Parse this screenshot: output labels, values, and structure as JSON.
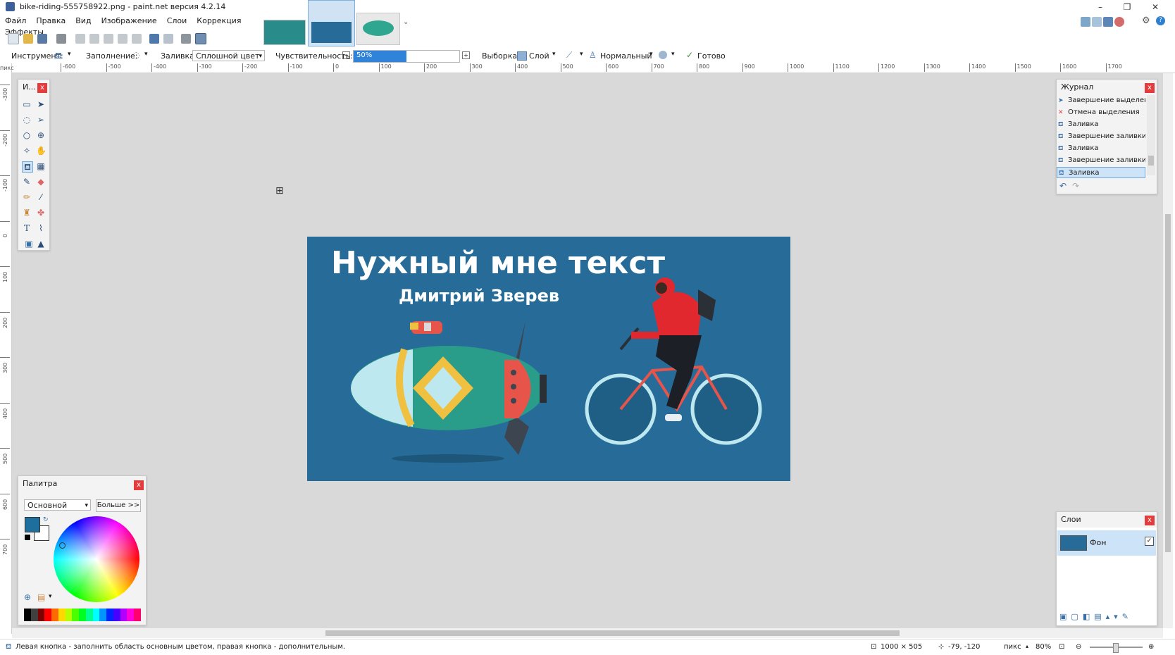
{
  "window": {
    "title": "bike-riding-555758922.png - paint.net версия 4.2.14",
    "minimize": "–",
    "restore": "❐",
    "close": "✕"
  },
  "menu": [
    "Файл",
    "Правка",
    "Вид",
    "Изображение",
    "Слои",
    "Коррекция",
    "Эффекты"
  ],
  "options": {
    "tool_label": "Инструмент:",
    "fillmode_label": "Заполнение:",
    "fill_label": "Заливка:",
    "fill_value": "Сплошной цвет",
    "tolerance_label": "Чувствительность:",
    "tolerance_value": "50%",
    "tolerance_fraction": 0.5,
    "sampling_label": "Выборка:",
    "sampling_value": "Слой",
    "blend_value": "Нормальный",
    "finish_label": "Готово"
  },
  "ruler": {
    "unit": "пикс",
    "h_ticks": [
      "-600",
      "-500",
      "-400",
      "-300",
      "-200",
      "-100",
      "0",
      "100",
      "200",
      "300",
      "400",
      "500",
      "600",
      "700",
      "800",
      "900",
      "1000",
      "1100",
      "1200",
      "1300",
      "1400",
      "1500",
      "1600",
      "1700"
    ],
    "v_ticks": [
      "-300",
      "-200",
      "-100",
      "0",
      "100",
      "200",
      "300",
      "400",
      "500",
      "600",
      "700"
    ]
  },
  "tools_panel": {
    "title": "И...",
    "close": "x"
  },
  "canvas_image": {
    "title": "Нужный мне текст",
    "subtitle": "Дмитрий Зверев",
    "bg_color": "#276c98"
  },
  "history": {
    "title": "Журнал",
    "close": "x",
    "items": [
      {
        "label": "Завершение выделения",
        "icon": "select-icon"
      },
      {
        "label": "Отмена выделения",
        "icon": "deselect-icon"
      },
      {
        "label": "Заливка",
        "icon": "bucket-icon"
      },
      {
        "label": "Завершение заливки",
        "icon": "bucket-icon"
      },
      {
        "label": "Заливка",
        "icon": "bucket-icon"
      },
      {
        "label": "Завершение заливки",
        "icon": "bucket-icon"
      },
      {
        "label": "Заливка",
        "icon": "bucket-icon"
      }
    ]
  },
  "palette": {
    "title": "Палитра",
    "close": "x",
    "mode": "Основной",
    "more": "Больше >>",
    "primary_color": "#1f6f9e",
    "secondary_color": "#ffffff",
    "swatches": [
      "#000000",
      "#404040",
      "#7f0000",
      "#ff0000",
      "#ff6a00",
      "#ffd800",
      "#b6ff00",
      "#4cff00",
      "#00ff21",
      "#00ff90",
      "#00ffff",
      "#0094ff",
      "#0026ff",
      "#4800ff",
      "#b200ff",
      "#ff00dc",
      "#ff006e"
    ]
  },
  "layers": {
    "title": "Слои",
    "close": "x",
    "items": [
      {
        "name": "Фон",
        "visible": true
      }
    ]
  },
  "status": {
    "hint": "Левая кнопка - заполнить область основным цветом, правая кнопка - дополнительным.",
    "size": "1000 × 505",
    "cursor": "-79, -120",
    "unit": "пикс",
    "zoom": "80%"
  }
}
